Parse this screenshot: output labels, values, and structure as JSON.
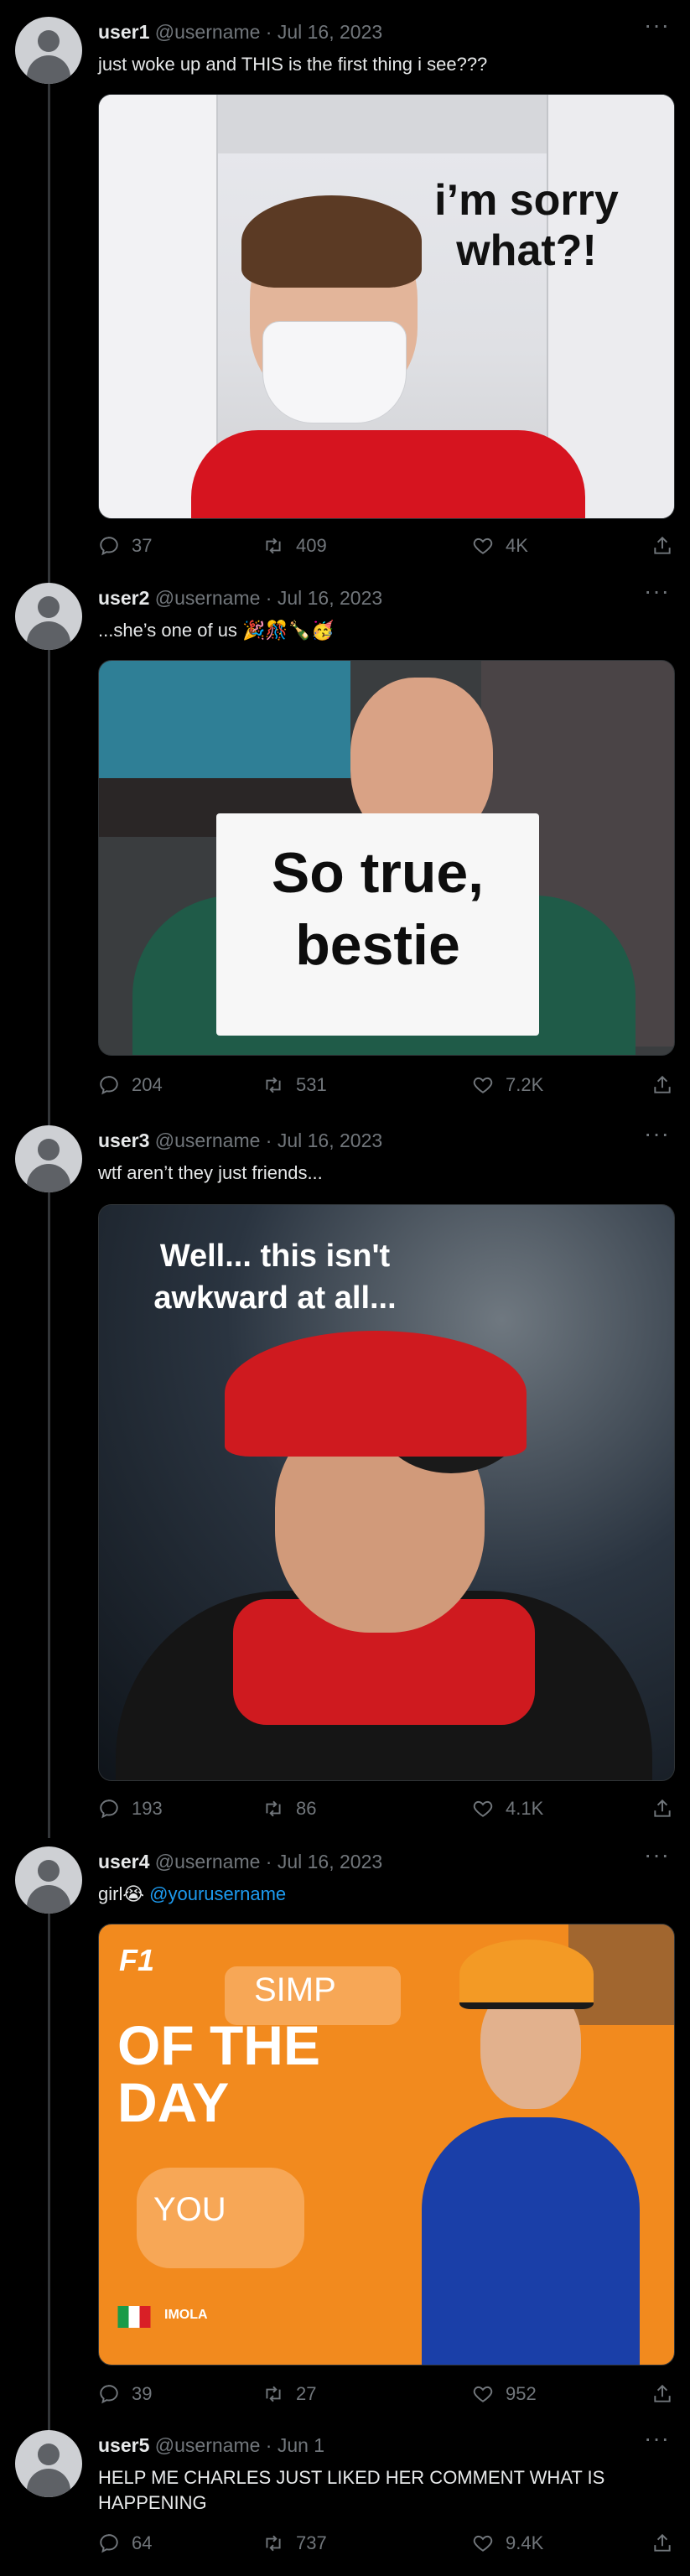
{
  "tweets": [
    {
      "name": "user1",
      "meta": "@username · Jul 16, 2023",
      "text": "just woke up and THIS is the first thing i see???",
      "media_caption": "i’m sorry what?!",
      "replies": "37",
      "retweets": "409",
      "likes": "4K"
    },
    {
      "name": "user2",
      "meta": "@username · Jul 16, 2023",
      "text": "...she’s one of us 🎉🎊🍾🥳",
      "media_caption": "So true, bestie",
      "replies": "204",
      "retweets": "531",
      "likes": "7.2K"
    },
    {
      "name": "user3",
      "meta": "@username · Jul 16, 2023",
      "text": "wtf aren’t they just friends...",
      "media_caption": "Well... this isn't awkward at all...",
      "replies": "193",
      "retweets": "86",
      "likes": "4.1K"
    },
    {
      "name": "user4",
      "meta": "@username · Jul 16, 2023",
      "text": "girl😭",
      "mention": "@yourusername",
      "media_f1": "F1",
      "media_simp": "SIMP",
      "media_big": "OF THE DAY",
      "media_you": "YOU",
      "media_location": "IMOLA",
      "replies": "39",
      "retweets": "27",
      "likes": "952"
    },
    {
      "name": "user5",
      "meta": "@username · Jun 1",
      "text": "HELP ME CHARLES JUST LIKED HER COMMENT WHAT IS HAPPENING",
      "replies": "64",
      "retweets": "737",
      "likes": "9.4K"
    }
  ],
  "more_label": "···",
  "icons": [
    "reply-icon",
    "retweet-icon",
    "like-icon",
    "share-icon",
    "more-icon"
  ],
  "colors": {
    "background": "#000000",
    "text": "#e7e9ea",
    "muted": "#71767b",
    "link": "#1d9bf0"
  }
}
